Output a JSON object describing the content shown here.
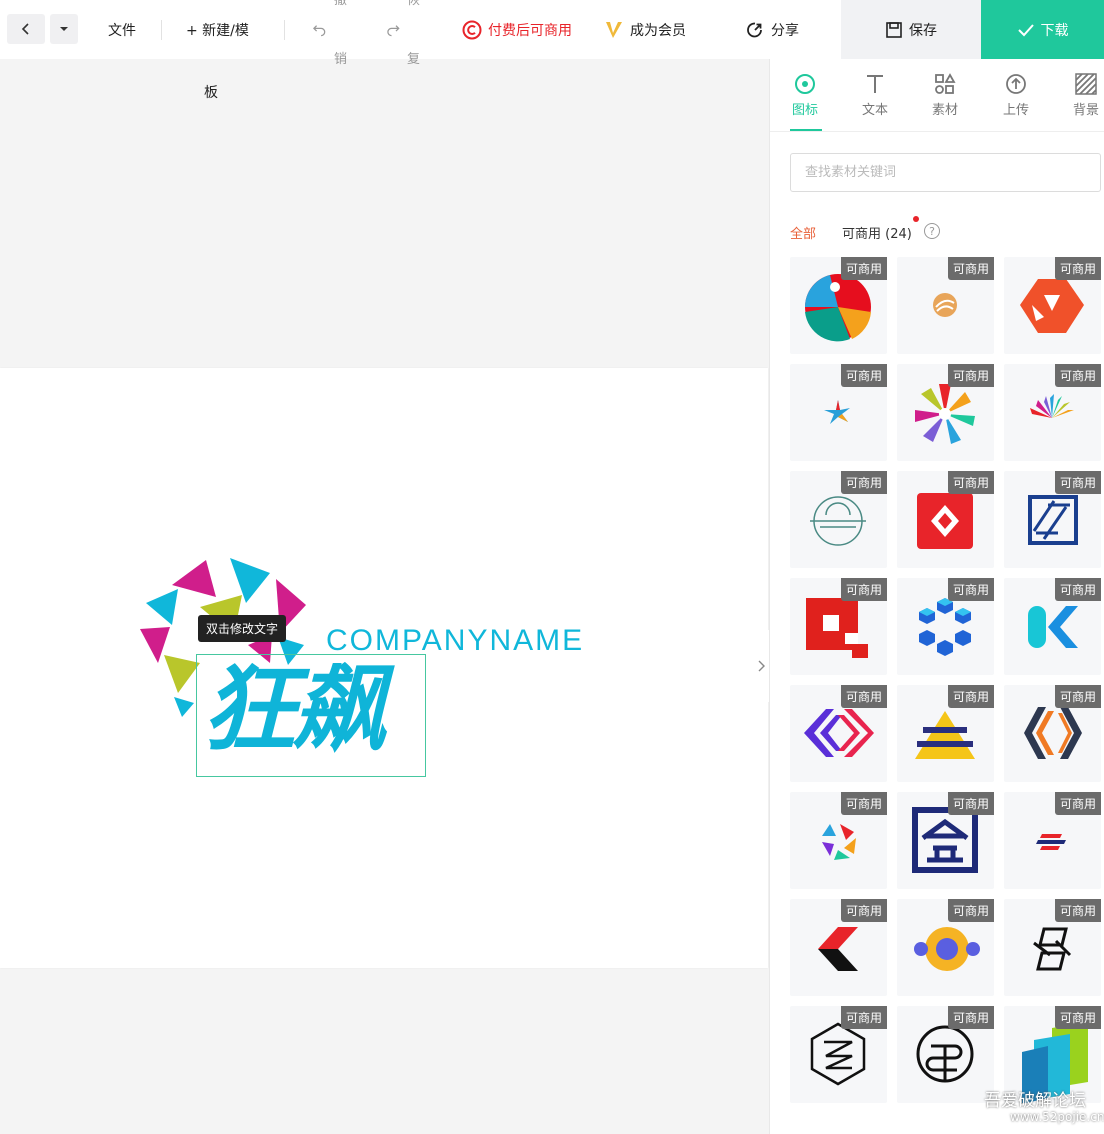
{
  "toolbar": {
    "file": "文件",
    "new_template_line1": "+ 新建/模",
    "new_template_line2": "板",
    "undo_top": "撤",
    "undo_bottom": "销",
    "redo_top": "恢",
    "redo_bottom": "复",
    "paid_commercial": "付费后可商用",
    "become_member": "成为会员",
    "share": "分享",
    "save": "保存",
    "download": "下载"
  },
  "canvas": {
    "tooltip": "双击修改文字",
    "company_name": "COMPANYNAME",
    "big_text": "狂飙"
  },
  "panel": {
    "tabs": [
      {
        "label": "图标",
        "icon": "target-icon",
        "active": true
      },
      {
        "label": "文本",
        "icon": "text-icon",
        "active": false
      },
      {
        "label": "素材",
        "icon": "shapes-icon",
        "active": false
      },
      {
        "label": "上传",
        "icon": "upload-icon",
        "active": false
      },
      {
        "label": "背景",
        "icon": "stripes-icon",
        "active": false
      }
    ],
    "search_placeholder": "查找素材关键词",
    "filter_all": "全部",
    "filter_commercial": "可商用 (24)",
    "help": "?",
    "badge": "可商用"
  },
  "colors": {
    "accent": "#1fc89c",
    "brand_cyan": "#10b7da",
    "filter_active": "#e8613a",
    "paid_red": "#e8242a"
  },
  "watermark": {
    "line1": "吾爱破解论坛",
    "line2": "www.52pojie.cn"
  }
}
